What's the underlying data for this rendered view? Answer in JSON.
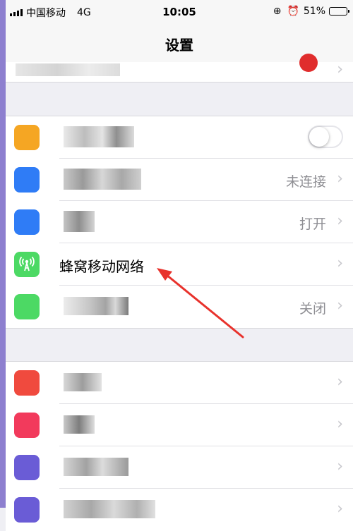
{
  "status_bar": {
    "carrier": "中国移动",
    "network": "4G",
    "time": "10:05",
    "orientation_lock_icon": "orientation-lock-icon",
    "alarm_icon": "alarm-icon",
    "battery_percent": "51%",
    "battery_level": 0.51
  },
  "nav": {
    "title": "设置"
  },
  "top_row": {
    "badge_color": "#e02d2d"
  },
  "group1": {
    "rows": [
      {
        "icon_color": "#f5a623",
        "has_toggle": true,
        "toggle_on": false
      },
      {
        "icon_color": "#2f7cf6",
        "value": "未连接"
      },
      {
        "icon_color": "#2f7cf6",
        "value": "打开"
      },
      {
        "icon_color": "#4cd964",
        "icon": "cellular-antenna-icon",
        "label": "蜂窝移动网络"
      },
      {
        "icon_color": "#4cd964",
        "value": "关闭"
      }
    ]
  },
  "group2": {
    "rows": [
      {
        "icon_color": "#f04a3e"
      },
      {
        "icon_color": "#f23a5c"
      },
      {
        "icon_color": "#6a5cd6"
      },
      {
        "icon_color": "#6a5cd6"
      }
    ]
  },
  "annotation": {
    "arrow_color": "#e8322c"
  }
}
